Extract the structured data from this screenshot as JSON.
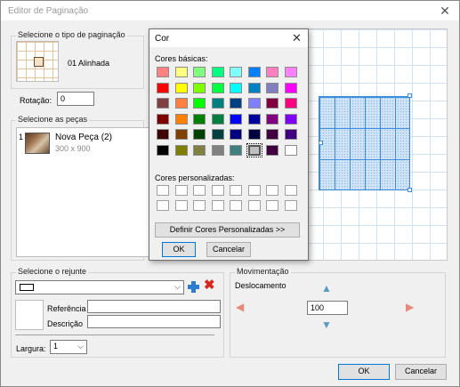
{
  "window": {
    "title": "Editor de Paginação",
    "close_glyph": "✕"
  },
  "pagination": {
    "legend": "Selecione o tipo de paginação",
    "type_label": "01 Alinhada",
    "rotation_label": "Rotação:",
    "rotation_value": "0"
  },
  "pieces": {
    "legend": "Selecione as peças",
    "items": [
      {
        "index": "1",
        "name": "Nova Peça (2)",
        "size": "300 x 900"
      }
    ]
  },
  "grout": {
    "legend": "Selecione o rejunte",
    "referencia_label": "Referência",
    "descricao_label": "Descrição",
    "referencia_value": "",
    "descricao_value": "",
    "largura_label": "Largura:",
    "largura_value": "1",
    "add_icon": "plus-icon",
    "remove_icon": "x-icon"
  },
  "movement": {
    "legend": "Movimentação",
    "displacement_label": "Deslocamento",
    "displacement_value": "100"
  },
  "footer": {
    "ok_label": "OK",
    "cancel_label": "Cancelar"
  },
  "color_dialog": {
    "title": "Cor",
    "close_glyph": "✕",
    "basic_label": "Cores básicas:",
    "custom_label": "Cores personalizadas:",
    "define_label": "Definir Cores Personalizadas >>",
    "ok_label": "OK",
    "cancel_label": "Cancelar",
    "basic_colors": [
      "#ff8080",
      "#ffff80",
      "#80ff80",
      "#00ff80",
      "#80ffff",
      "#0080ff",
      "#ff80c0",
      "#ff80ff",
      "#ff0000",
      "#ffff00",
      "#80ff00",
      "#00ff40",
      "#00ffff",
      "#0080c0",
      "#8080c0",
      "#ff00ff",
      "#804040",
      "#ff8040",
      "#00ff00",
      "#008080",
      "#004080",
      "#8080ff",
      "#800040",
      "#ff0080",
      "#800000",
      "#ff8000",
      "#008000",
      "#008040",
      "#0000ff",
      "#0000a0",
      "#800080",
      "#8000ff",
      "#400000",
      "#804000",
      "#004000",
      "#004040",
      "#000080",
      "#000040",
      "#400040",
      "#400080",
      "#000000",
      "#808000",
      "#808040",
      "#808080",
      "#408080",
      "#c0c0c0",
      "#400040",
      "#ffffff"
    ],
    "selected_index": 45
  },
  "accent": {
    "blue": "#3b8ede",
    "red": "#d9261c",
    "plus_blue": "#2c7cd1"
  }
}
